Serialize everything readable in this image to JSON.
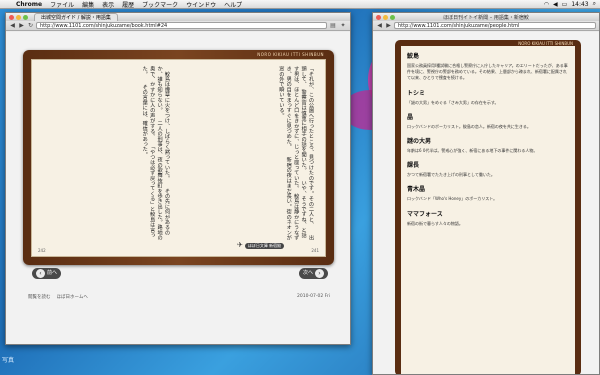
{
  "menubar": {
    "apple": "",
    "items": [
      "Chrome",
      "ファイル",
      "編集",
      "表示",
      "履歴",
      "ブックマーク",
      "ウインドウ",
      "ヘルプ"
    ],
    "clock": "14:43"
  },
  "window_left": {
    "tab_title": "出城空間ガイド / 解説・用語集",
    "url": "http://www.1101.com/shinjukuzame/book.html#24",
    "book_header": "NORO KIKIAU ITTI SHINBUN",
    "page_left_number": "242",
    "page_right_number": "241",
    "seal_badge": "ほぼ日文庫 新宿鮫",
    "col_right_text": "「それが、この公園へ行ったところ、見つけたのです。その二人と、　　出頭して、　警察官は慎重に相手の話を聞いた。　　いや、そうですね、と話す男は、ほとんど口をきかずに、じっと座っていた。　鮫島は静かにうなずき、男の目をまっすぐに見つめた。　　新宿の夜はまだ長い。街のネオンが窓の外で瞬いている。",
    "col_left_text": "　鮫島は煙草に火をつけ、しばらく黙っていた。　　その先に何があるのか、誰も知らない。　　二人の刑事は、夜の歌舞伎町を歩き出した。路地の奥で、かすかに人の声がする。　　「やつは必ず戻ってくる」と鮫島は言った。　　その言葉には、確信があった。",
    "prev_label": "前へ",
    "next_label": "次へ",
    "footer_link1": "閲覧を読む",
    "footer_link2": "ほぼ日ホームへ",
    "footer_date": "2010-07-02 Fri"
  },
  "window_right": {
    "title": "ほぼ日刊イトイ新聞 – 用語集・新宿鮫",
    "url": "http://www.1101.com/shinjukuzame/people.html",
    "header": "NORO KIKIAU ITTI SHINBUN",
    "entries": [
      {
        "name": "鮫島",
        "desc": "国家公務員採用I種試験に合格し警察庁に入庁したキャリア。のエリートだったが、ある事件を境に、警視庁の警部を務めている。その結果、上層部から疎まれ、新宿署に配属されて以来、ひとりで捜査を続ける。"
      },
      {
        "name": "トシミ",
        "desc": "「謎の大男」をめぐる「さみ大男」の存在を示す。"
      },
      {
        "name": "晶",
        "desc": "ロックバンドのボーカリスト。鮫島の恋人。新宿の夜を共に生きる。"
      },
      {
        "name": "謎の大男",
        "desc": "年齢は6 0代半ば。警戒心が強く、新宿にある地下の事件に関わる人物。"
      },
      {
        "name": "課長",
        "desc": "かつて新宿署でたたき上げの刑事として働いた。"
      },
      {
        "name": "青木晶",
        "desc": "ロックバンド「Who's Honey」のボーカリスト。"
      },
      {
        "name": "ママフォース",
        "desc": "新宿の街で暮らす人々の物語。"
      }
    ]
  },
  "desktop": {
    "label": "写真"
  }
}
